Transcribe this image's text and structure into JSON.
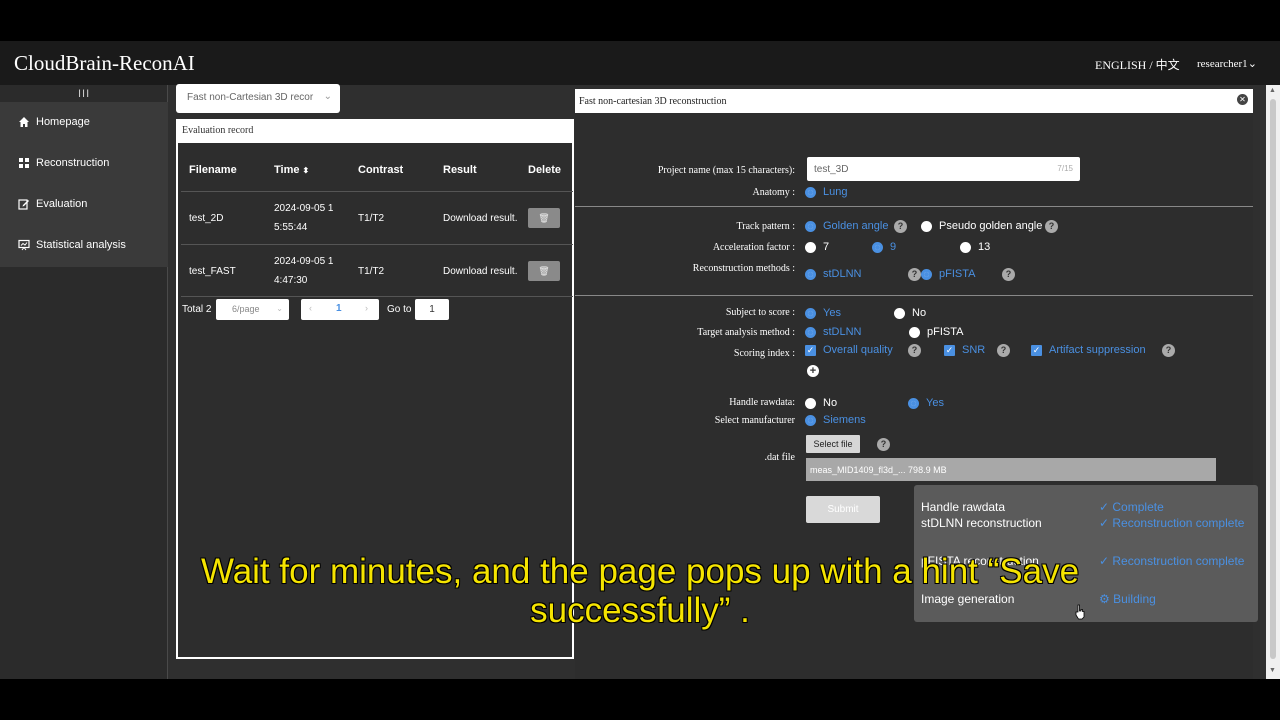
{
  "app": {
    "title": "CloudBrain-ReconAI",
    "language": "ENGLISH / 中文",
    "user": "researcher1"
  },
  "sidebar": {
    "toggle": "III",
    "items": [
      {
        "label": "Homepage",
        "icon": "home-icon"
      },
      {
        "label": "Reconstruction",
        "icon": "grid-icon"
      },
      {
        "label": "Evaluation",
        "icon": "edit-icon"
      },
      {
        "label": "Statistical analysis",
        "icon": "chart-icon"
      }
    ]
  },
  "record_select": {
    "value": "Fast non-Cartesian 3D recor"
  },
  "evaluation": {
    "header": "Evaluation record",
    "columns": [
      "Filename",
      "Time",
      "Contrast",
      "Result",
      "Delete"
    ],
    "rows": [
      {
        "filename": "test_2D",
        "time_1": "2024-09-05 1",
        "time_2": "5:55:44",
        "contrast": "T1/T2",
        "result": "Download result."
      },
      {
        "filename": "test_FAST",
        "time_1": "2024-09-05 1",
        "time_2": "4:47:30",
        "contrast": "T1/T2",
        "result": "Download result."
      }
    ],
    "pager": {
      "total": "Total 2",
      "page_size": "6/page",
      "current_page": "1",
      "goto_label": "Go to",
      "goto_value": "1"
    }
  },
  "dialog": {
    "title": "Fast non-cartesian 3D reconstruction",
    "project_name_label": "Project name (max 15 characters):",
    "project_name_value": "test_3D",
    "project_name_count": "7/15",
    "anatomy_label": "Anatomy :",
    "anatomy_value": "Lung",
    "track_label": "Track pattern :",
    "track_opt1": "Golden angle",
    "track_opt2": "Pseudo golden angle",
    "accel_label": "Acceleration factor :",
    "accel_opt1": "7",
    "accel_opt2": "9",
    "accel_opt3": "13",
    "recon_label": "Reconstruction methods :",
    "recon_opt1": "stDLNN",
    "recon_opt2": "pFISTA",
    "score_label": "Subject to score :",
    "score_yes": "Yes",
    "score_no": "No",
    "target_label": "Target analysis method :",
    "target_opt1": "stDLNN",
    "target_opt2": "pFISTA",
    "index_label": "Scoring index :",
    "index_opt1": "Overall quality",
    "index_opt2": "SNR",
    "index_opt3": "Artifact suppression",
    "rawdata_label": "Handle rawdata:",
    "rawdata_no": "No",
    "rawdata_yes": "Yes",
    "manufacturer_label": "Select manufacturer",
    "manufacturer_value": "Siemens",
    "dat_label": ".dat file",
    "select_file": "Select file",
    "file_name": "meas_MID1409_fl3d_...   798.9 MB",
    "submit": "Submit"
  },
  "progress": [
    {
      "step": "Handle rawdata",
      "status": "✓ Complete"
    },
    {
      "step": "stDLNN reconstruction",
      "status": "✓ Reconstruction complete"
    },
    {
      "step": "pFISTA reconstruction",
      "status": "✓ Reconstruction complete"
    },
    {
      "step": "Image generation",
      "status": "⚙ Building"
    }
  ],
  "subtitle": {
    "line1": "Wait for minutes, and the page pops up with a hint “Save",
    "line2": "successfully” ."
  },
  "colors": {
    "accent": "#4a90e2",
    "subtitle": "#f5e400"
  }
}
